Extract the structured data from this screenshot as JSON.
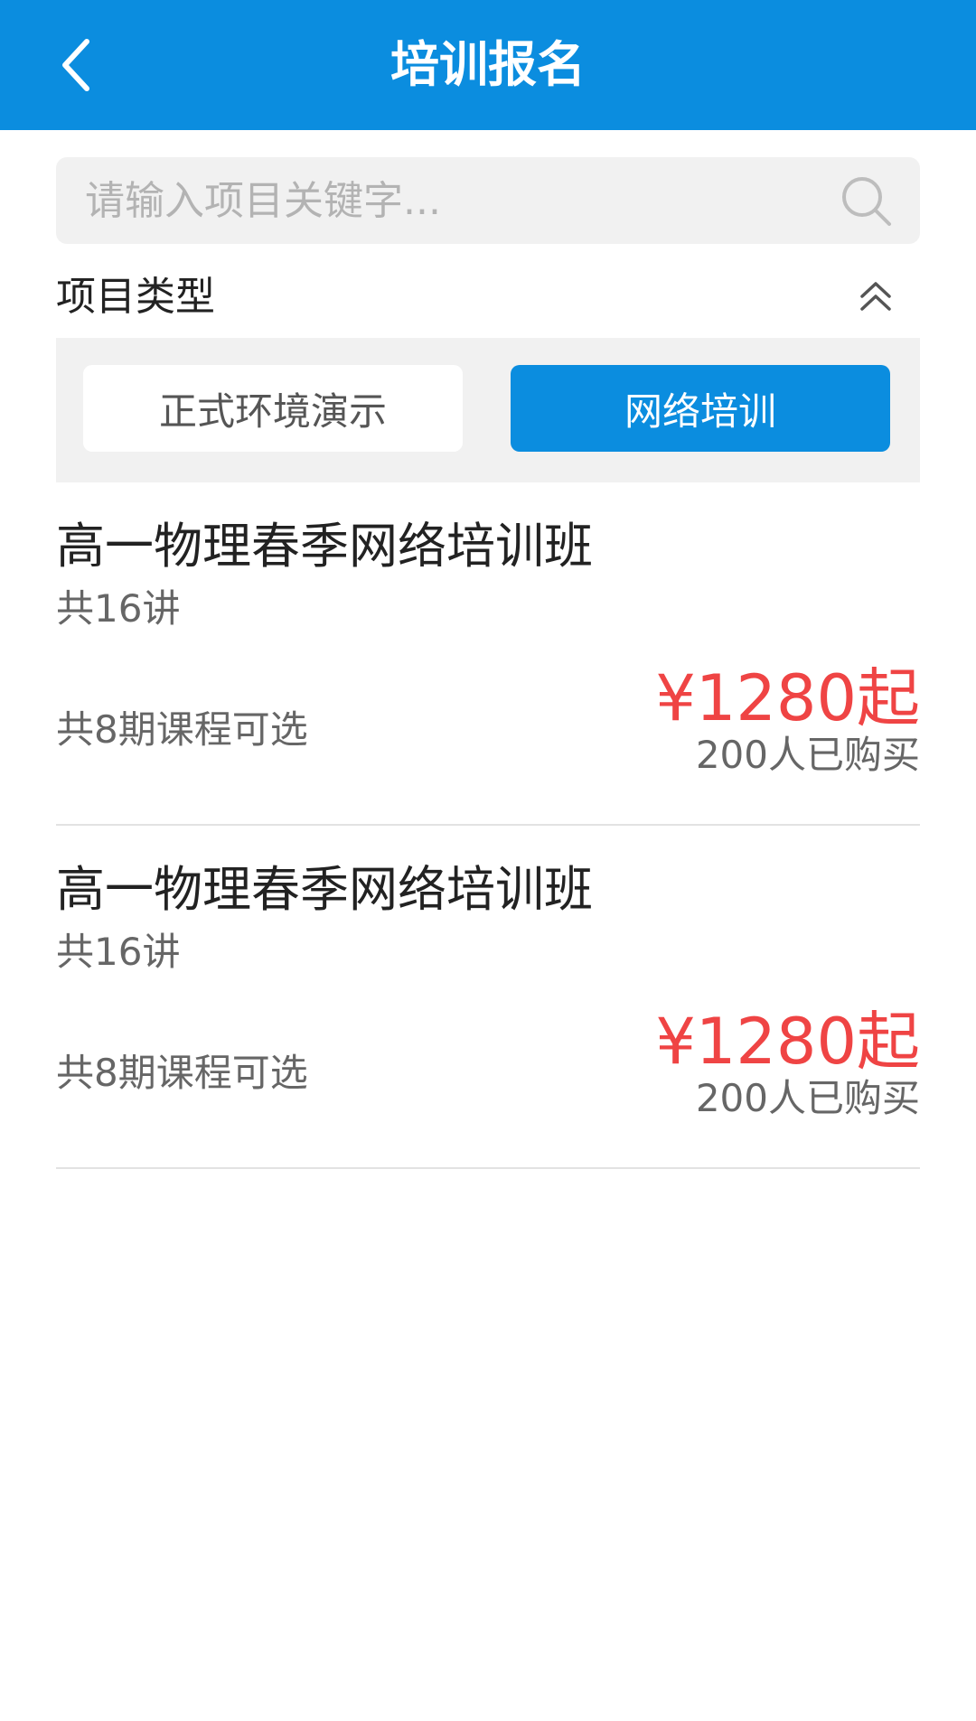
{
  "header": {
    "title": "培训报名",
    "back_icon": "chevron-left-icon"
  },
  "search": {
    "placeholder": "请输入项目关键字...",
    "value": "",
    "icon": "search-icon"
  },
  "filter": {
    "title": "项目类型",
    "collapse_icon": "double-chevron-up-icon",
    "options": [
      {
        "label": "正式环境演示",
        "selected": false
      },
      {
        "label": "网络培训",
        "selected": true
      }
    ]
  },
  "courses": [
    {
      "title": "高一物理春季网络培训班",
      "lectures": "共16讲",
      "periods": "共8期课程可选",
      "price": "¥1280起",
      "buyers": "200人已购买"
    },
    {
      "title": "高一物理春季网络培训班",
      "lectures": "共16讲",
      "periods": "共8期课程可选",
      "price": "¥1280起",
      "buyers": "200人已购买"
    }
  ],
  "colors": {
    "primary": "#0B8DDF",
    "price": "#EF4444",
    "panel_bg": "#F1F1F1"
  }
}
